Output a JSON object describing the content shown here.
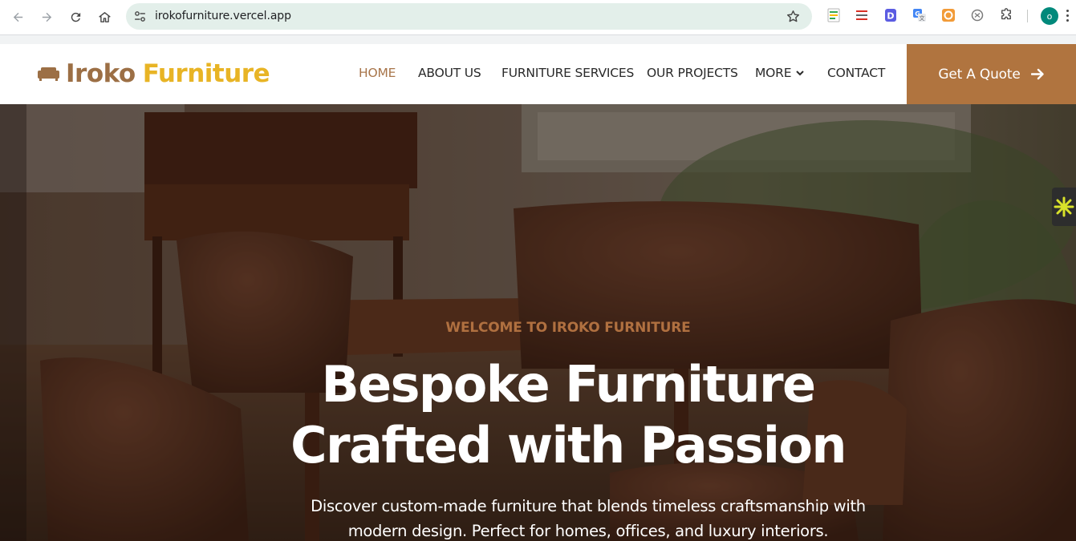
{
  "browser": {
    "url": "irokofurniture.vercel.app",
    "profile_initial": "o",
    "extensions": [
      "sheets-extension-icon",
      "bookmarks-extension-icon",
      "d-extension-icon",
      "translate-extension-icon",
      "orange-extension-icon",
      "openai-extension-icon",
      "puzzle-icon"
    ]
  },
  "site": {
    "logo": {
      "word1": "Iroko",
      "word2": "Furniture"
    },
    "nav": [
      {
        "label": "HOME",
        "active": true
      },
      {
        "label": "ABOUT US"
      },
      {
        "label": "FURNITURE SERVICES"
      },
      {
        "label": "OUR PROJECTS"
      },
      {
        "label": "MORE"
      },
      {
        "label": "CONTACT"
      }
    ],
    "quote_button": "Get A Quote"
  },
  "hero": {
    "kicker": "WELCOME TO IROKO FURNITURE",
    "title_line1": "Bespoke Furniture",
    "title_line2": "Crafted with Passion",
    "description_line1": "Discover custom-made furniture that blends timeless craftsmanship with",
    "description_line2": "modern design. Perfect for homes, offices, and luxury interiors."
  },
  "colors": {
    "brand_brown": "#9c6f45",
    "brand_gold": "#e8b425",
    "accent": "#b0743f",
    "omnibox_bg": "#e3efea"
  }
}
